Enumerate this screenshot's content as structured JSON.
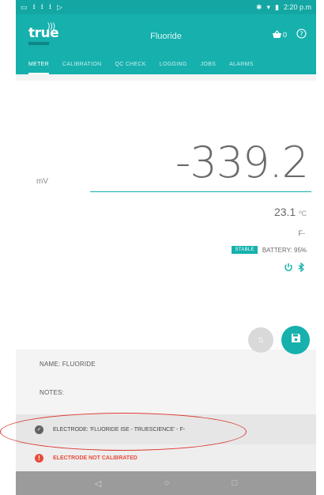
{
  "status_bar": {
    "left_icons": [
      "notification-icon",
      "download-icon",
      "download-icon",
      "download-icon",
      "play-store-icon"
    ],
    "time": "2:20 p.m"
  },
  "header": {
    "logo_text": "true",
    "title": "Fluoride",
    "cart_count": "0"
  },
  "tabs": [
    {
      "label": "METER",
      "active": true
    },
    {
      "label": "CALIBRATION",
      "active": false
    },
    {
      "label": "QC CHECK",
      "active": false
    },
    {
      "label": "LOGGING",
      "active": false
    },
    {
      "label": "JOBS",
      "active": false
    },
    {
      "label": "ALARMS",
      "active": false
    }
  ],
  "meter": {
    "unit": "mV",
    "reading": "-339.2",
    "temperature": "23.1",
    "temperature_unit": "ºC",
    "ion": "F-",
    "stability": "STABLE",
    "battery": "BATTERY: 95%"
  },
  "info": {
    "name": "NAME: FLUORIDE",
    "notes": "NOTES:",
    "electrode": "ELECTRODE: 'FLUORIDE ISE - TRUESCIENCE' - F-",
    "calibration": "ELECTRODE NOT CALIBRATED"
  },
  "colors": {
    "accent": "#16b0ad",
    "warning": "#e74c3c",
    "annotation": "#d9352c"
  }
}
